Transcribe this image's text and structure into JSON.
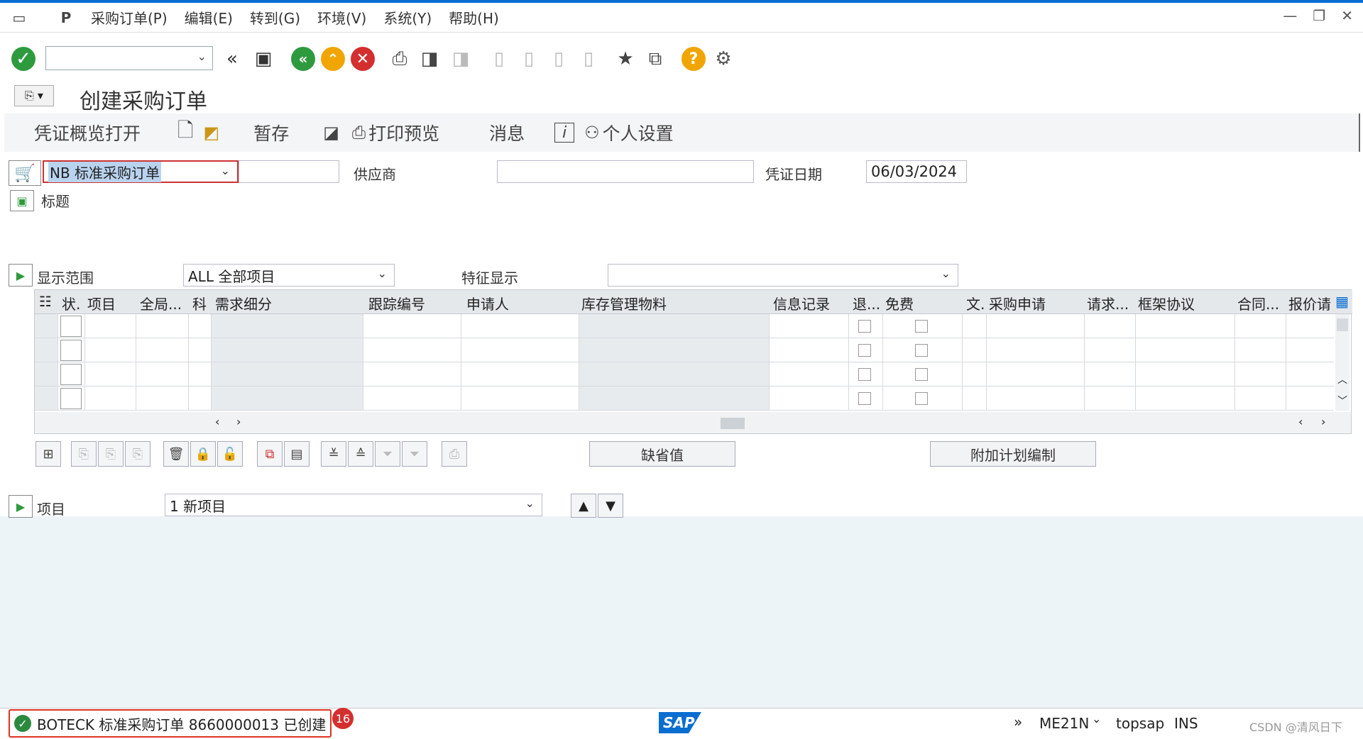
{
  "menu": {
    "items": [
      "采购订单(P)",
      "编辑(E)",
      "转到(G)",
      "环境(V)",
      "系统(Y)",
      "帮助(H)"
    ]
  },
  "page": {
    "title": "创建采购订单"
  },
  "app_toolbar": {
    "overview": "凭证概览打开",
    "hold": "暂存",
    "print_preview": "打印预览",
    "messages": "消息",
    "personal_settings": "个人设置"
  },
  "header": {
    "doc_type": "NB 标准采购订单",
    "vendor_label": "供应商",
    "vendor_value": "",
    "doc_date_label": "凭证日期",
    "doc_date_value": "06/03/2024",
    "header_label": "标题"
  },
  "items_overview": {
    "display_scope_label": "显示范围",
    "display_scope_value": "ALL 全部项目",
    "feature_label": "特征显示",
    "feature_value": "",
    "columns": [
      "状.",
      "项目",
      "全局...",
      "科",
      "需求细分",
      "跟踪编号",
      "申请人",
      "库存管理物料",
      "信息记录",
      "退...",
      "免费",
      "文.",
      "采购申请",
      "请求...",
      "框架协议",
      "合同...",
      "报价请"
    ],
    "default_values_button": "缺省值",
    "additional_planning_button": "附加计划编制"
  },
  "item_detail": {
    "label": "项目",
    "value": "1 新项目"
  },
  "status": {
    "message": "BOTECK 标准采购订单 8660000013 已创建",
    "badge": "16",
    "sap_logo": "SAP",
    "transaction": "ME21N",
    "server": "topsap",
    "mode": "INS",
    "watermark": "CSDN @清风日下"
  }
}
